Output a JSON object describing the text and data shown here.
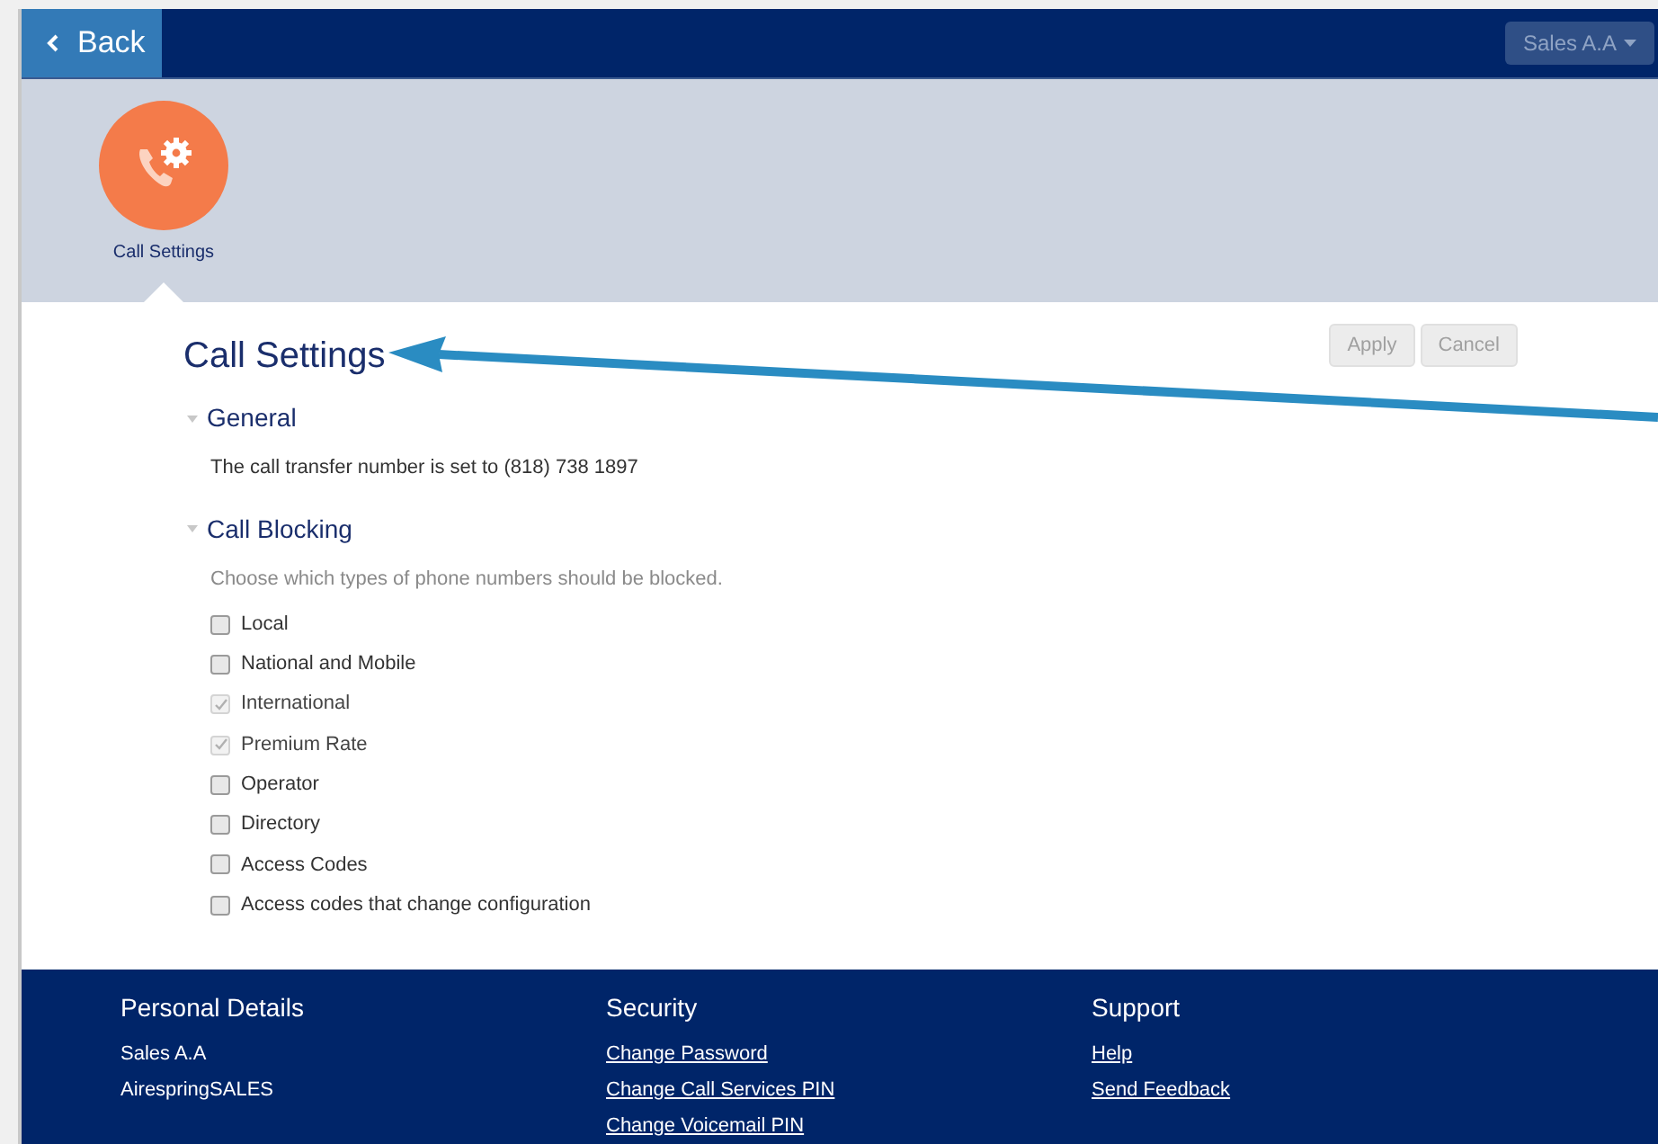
{
  "nav": {
    "back_label": "Back",
    "user_menu": "Sales A.A"
  },
  "tile": {
    "label": "Call Settings"
  },
  "page": {
    "title": "Call Settings",
    "buttons": [
      {
        "label": "Apply",
        "disabled": true
      },
      {
        "label": "Cancel",
        "disabled": true
      }
    ]
  },
  "sections": [
    {
      "title": "General",
      "expanded": true,
      "text": "The call transfer number is set to (818) 738 1897",
      "hint_style": false
    },
    {
      "title": "Call Blocking",
      "expanded": true,
      "text": "Choose which types of phone numbers should be blocked.",
      "hint_style": true,
      "options": [
        {
          "label": "Local",
          "checked": false
        },
        {
          "label": "National and Mobile",
          "checked": false
        },
        {
          "label": "International",
          "checked": true
        },
        {
          "label": "Premium Rate",
          "checked": true
        },
        {
          "label": "Operator",
          "checked": false
        },
        {
          "label": "Directory",
          "checked": false
        },
        {
          "label": "Access Codes",
          "checked": false
        },
        {
          "label": "Access codes that change configuration",
          "checked": false
        }
      ]
    }
  ],
  "footer": {
    "columns": [
      {
        "title": "Personal Details",
        "items": [
          {
            "text": "Sales A.A",
            "link": false
          },
          {
            "text": "AirespringSALES",
            "link": false
          }
        ]
      },
      {
        "title": "Security",
        "items": [
          {
            "text": "Change Password",
            "link": true
          },
          {
            "text": "Change Call Services PIN",
            "link": true
          },
          {
            "text": "Change Voicemail PIN",
            "link": true
          }
        ]
      },
      {
        "title": "Support",
        "items": [
          {
            "text": "Help",
            "link": true
          },
          {
            "text": "Send Feedback",
            "link": true
          }
        ]
      }
    ]
  }
}
